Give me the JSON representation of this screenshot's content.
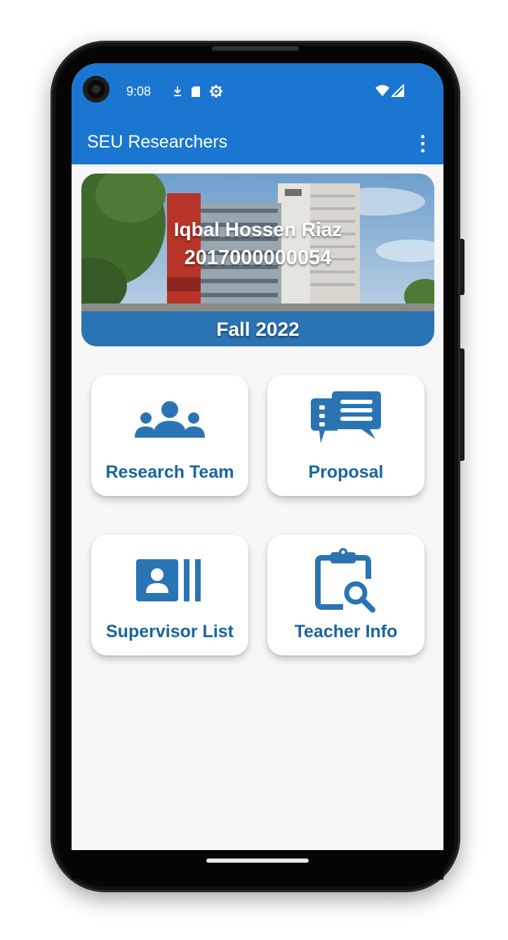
{
  "status_bar": {
    "time": "9:08",
    "icons": [
      "download-icon",
      "sd-card-icon",
      "settings-icon"
    ],
    "right_icons": [
      "wifi-icon",
      "cellular-signal-icon"
    ]
  },
  "app_bar": {
    "title": "SEU Researchers",
    "overflow_icon": "more-vert-icon",
    "color": "#1b76d2"
  },
  "banner": {
    "name": "Iqbal Hossen Riaz",
    "student_id": "2017000000054",
    "term": "Fall  2022"
  },
  "cards": [
    {
      "label": "Research Team",
      "icon": "users-group-icon"
    },
    {
      "label": "Proposal",
      "icon": "chat-bubbles-icon"
    },
    {
      "label": "Supervisor List",
      "icon": "contact-card-icon"
    },
    {
      "label": "Teacher Info",
      "icon": "clipboard-search-icon"
    }
  ],
  "colors": {
    "accent": "#1b76d2",
    "card_text": "#17659e",
    "card_icon": "#2b74b4",
    "background": "#f7f7f7"
  }
}
